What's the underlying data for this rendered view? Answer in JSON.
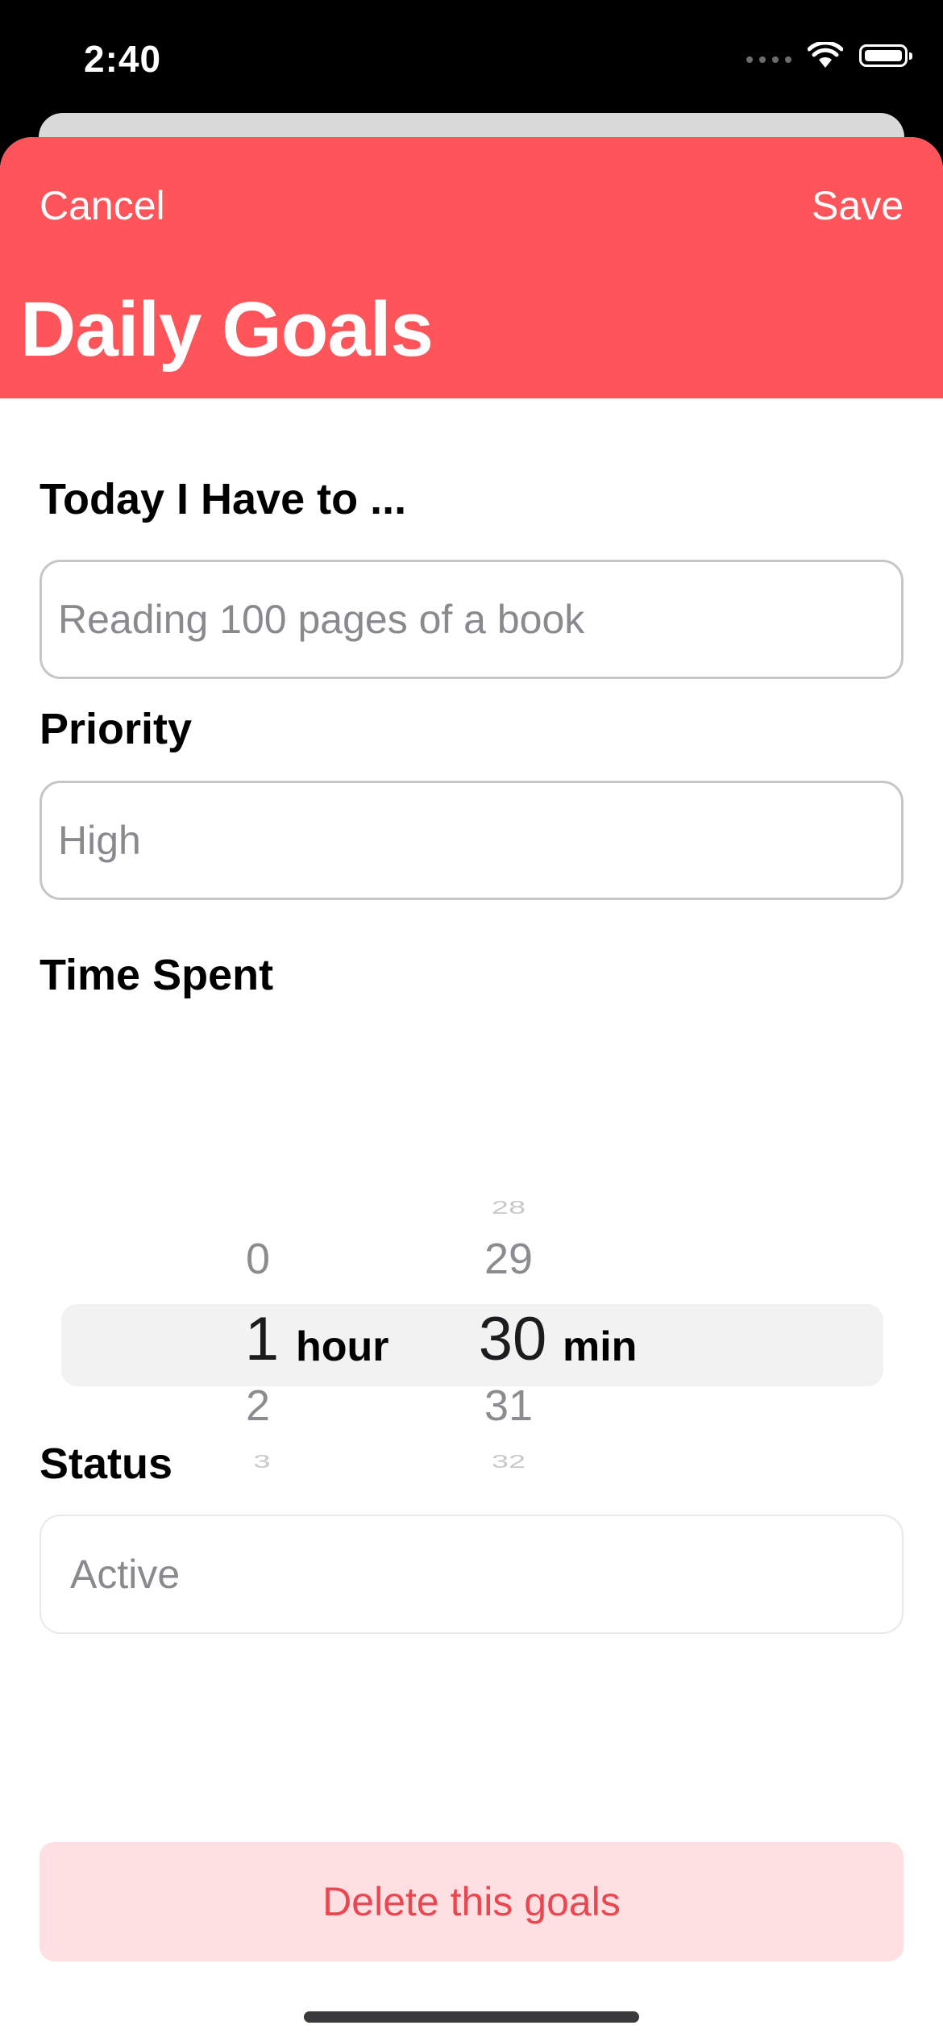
{
  "status_bar": {
    "time": "2:40"
  },
  "nav": {
    "cancel_label": "Cancel",
    "save_label": "Save",
    "title": "Daily Goals"
  },
  "form": {
    "task_label": "Today I Have to ...",
    "task_placeholder": "Reading 100 pages of a book",
    "priority_label": "Priority",
    "priority_placeholder": "High",
    "time_label": "Time Spent",
    "status_label": "Status",
    "status_placeholder": "Active"
  },
  "time_picker": {
    "hours": {
      "above2": "",
      "above1": "0",
      "selected": "1",
      "below1": "2",
      "below2": "3",
      "unit": "hour"
    },
    "minutes": {
      "above2": "28",
      "above1": "29",
      "selected": "30",
      "below1": "31",
      "below2": "32",
      "unit": "min"
    }
  },
  "actions": {
    "delete_label": "Delete this goals"
  },
  "colors": {
    "accent": "#ff5459",
    "delete_bg": "#ffe0e2",
    "delete_text": "#ec4650"
  }
}
